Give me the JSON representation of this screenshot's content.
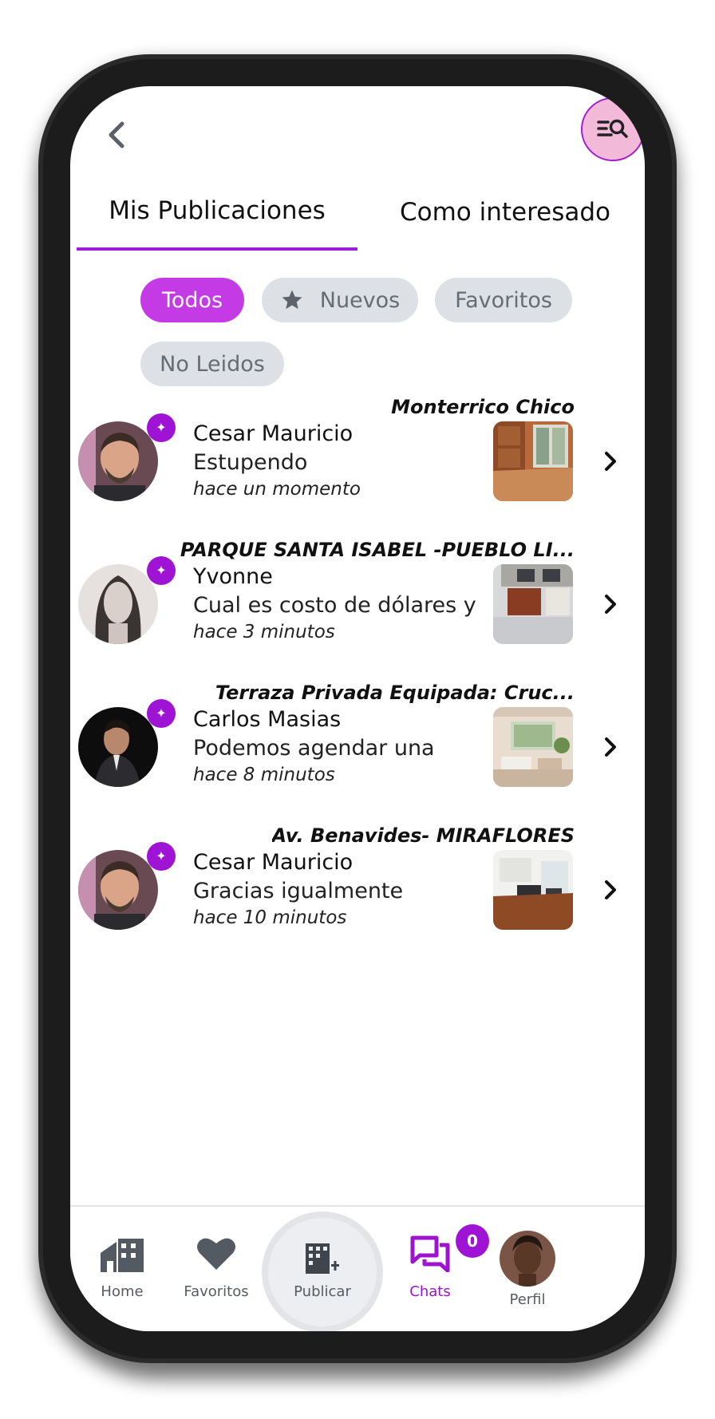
{
  "tabs": [
    {
      "label": "Mis Publicaciones",
      "active": true
    },
    {
      "label": "Como interesado",
      "active": false
    }
  ],
  "filters": [
    {
      "label": "Todos",
      "active": true
    },
    {
      "label": "Nuevos",
      "active": false,
      "icon": "star-icon"
    },
    {
      "label": "Favoritos",
      "active": false
    },
    {
      "label": "No Leidos",
      "active": false
    }
  ],
  "chats": [
    {
      "property": "Monterrico Chico",
      "name": "Cesar Mauricio",
      "message": "Estupendo",
      "time": "hace un momento"
    },
    {
      "property": "PARQUE SANTA ISABEL -PUEBLO LI...",
      "name": "Yvonne",
      "message": "Cual es costo de dólares y",
      "time": "hace 3 minutos"
    },
    {
      "property": "Terraza Privada Equipada: Cruc...",
      "name": "Carlos Masias",
      "message": "Podemos agendar una",
      "time": "hace 8 minutos"
    },
    {
      "property": "Av. Benavides- MIRAFLORES",
      "name": "Cesar Mauricio",
      "message": "Gracias igualmente",
      "time": "hace 10 minutos"
    }
  ],
  "nav": {
    "home": "Home",
    "favorites": "Favoritos",
    "publish": "Publicar",
    "chats": "Chats",
    "chats_count": "0",
    "profile": "Perfil"
  },
  "colors": {
    "accent": "#9f1fd6",
    "chip_active": "#c43ae4",
    "chip_inactive": "#dde1e6",
    "search_button": "#f3b9d9"
  }
}
